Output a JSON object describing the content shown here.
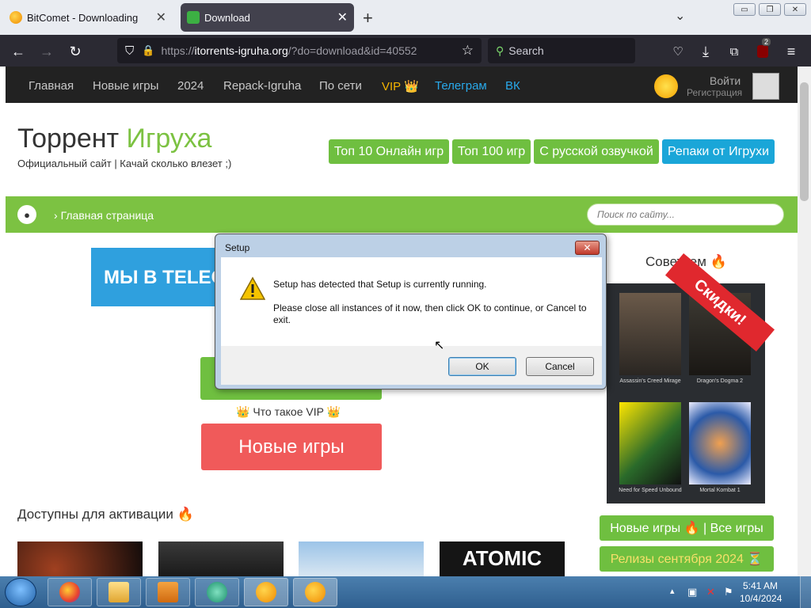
{
  "browser": {
    "tabs": [
      {
        "title": "BitComet - Downloading",
        "active": false
      },
      {
        "title": "Download",
        "active": true
      }
    ],
    "new_tab": "+",
    "url": {
      "scheme": "https://",
      "host": "itorrents-igruha.org",
      "path": "/?do=download&id=40552"
    },
    "search_placeholder": "Search",
    "extension_badge": "2",
    "window_controls": {
      "minimize": "▭",
      "restore": "❐",
      "close": "✕"
    }
  },
  "site": {
    "nav": [
      {
        "label": "Главная",
        "color": "#c8c8c8"
      },
      {
        "label": "Новые игры",
        "color": "#c8c8c8"
      },
      {
        "label": "2024",
        "color": "#c8c8c8"
      },
      {
        "label": "Repack-Igruha",
        "color": "#c8c8c8"
      },
      {
        "label": "По сети",
        "color": "#c8c8c8"
      },
      {
        "label": "VIP 👑",
        "color": "#f5b400"
      },
      {
        "label": "Телеграм",
        "color": "#29a9eb"
      },
      {
        "label": "ВК",
        "color": "#29a9eb"
      }
    ],
    "login": "Войти",
    "register": "Регистрация",
    "logo_part1": "Торрент ",
    "logo_part2": "Игруха",
    "tagline": "Официальный сайт | Качай сколько влезет ;)",
    "top_buttons": [
      "Топ 10 Онлайн игр",
      "Топ 100 игр",
      "С русской озвучкой",
      "Репаки от Игрухи"
    ],
    "breadcrumb": "Главная страница",
    "search_placeholder": "Поиск по сайту...",
    "telegram_banner": "МЫ В TELEGRAM",
    "vip_question": "👑 Что такое VIP 👑",
    "new_games_button": "Новые игры",
    "available_heading": "Доступны для активации 🔥",
    "advise_heading": "Советуем 🔥",
    "sale_ribbon": "Скидки!",
    "games": [
      {
        "caption": "Assassin's Creed Mirage"
      },
      {
        "caption": "Dragon's Dogma 2"
      },
      {
        "caption": "Need for Speed Unbound"
      },
      {
        "caption": "Mortal Kombat 1"
      }
    ],
    "side_buttons": [
      "Новые игры 🔥 | Все игры",
      "Релизы сентября 2024 ⏳"
    ]
  },
  "dialog": {
    "title": "Setup",
    "message1": "Setup has detected that Setup is currently running.",
    "message2": "Please close all instances of it now, then click OK to continue, or Cancel to exit.",
    "ok": "OK",
    "cancel": "Cancel"
  },
  "taskbar": {
    "time": "5:41 AM",
    "date": "10/4/2024"
  }
}
